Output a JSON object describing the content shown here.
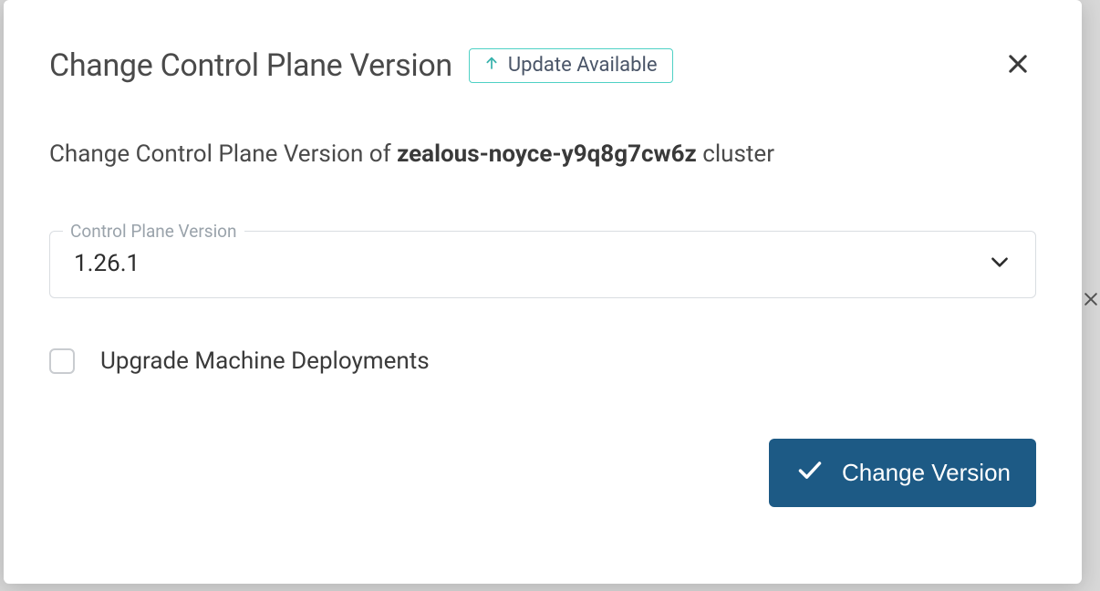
{
  "modal": {
    "title": "Change Control Plane Version",
    "badge": {
      "icon": "arrow-up-icon",
      "label": "Update Available"
    },
    "close_icon": "close-icon",
    "description_prefix": "Change Control Plane Version of ",
    "cluster_name": "zealous-noyce-y9q8g7cw6z",
    "description_suffix": " cluster",
    "field": {
      "label": "Control Plane Version",
      "value": "1.26.1",
      "chevron_icon": "chevron-down-icon"
    },
    "checkbox": {
      "checked": false,
      "label": "Upgrade Machine Deployments"
    },
    "primary_button": {
      "icon": "check-icon",
      "label": "Change Version"
    }
  }
}
